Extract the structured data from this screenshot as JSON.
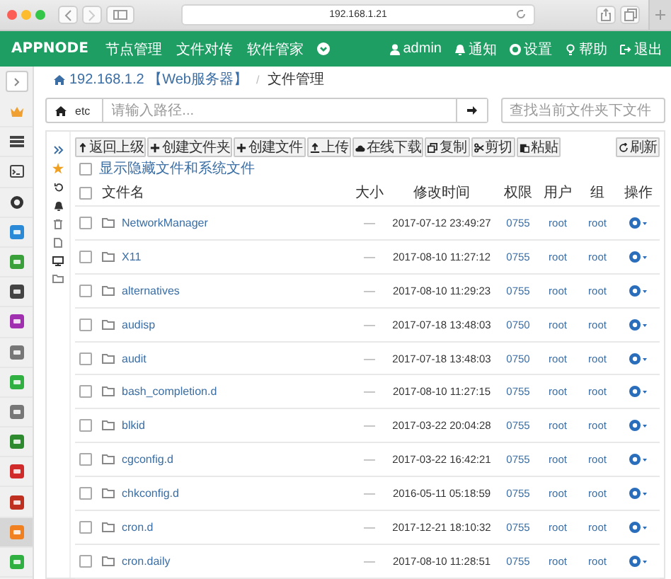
{
  "browser": {
    "address": "192.168.1.21"
  },
  "nav": {
    "logo": "APPNODE",
    "items": [
      {
        "label": "节点管理"
      },
      {
        "label": "文件对传"
      },
      {
        "label": "软件管家"
      }
    ],
    "user_items": [
      {
        "kind": "user",
        "label": "admin"
      },
      {
        "kind": "bell",
        "label": "通知"
      },
      {
        "kind": "gear",
        "label": "设置"
      },
      {
        "kind": "bulb",
        "label": "帮助"
      },
      {
        "kind": "logout",
        "label": "退出"
      }
    ]
  },
  "apps": [
    {
      "kind": "crown",
      "color": "#f0a030",
      "selected": false
    },
    {
      "kind": "list",
      "color": "#444444",
      "selected": false
    },
    {
      "kind": "terminal",
      "color": "#444444",
      "selected": false
    },
    {
      "kind": "gear",
      "color": "#333333",
      "selected": false
    },
    {
      "kind": "tile",
      "color": "#2a8ad8",
      "selected": false
    },
    {
      "kind": "tile",
      "color": "#3aa03a",
      "selected": false
    },
    {
      "kind": "tile",
      "color": "#444444",
      "selected": false
    },
    {
      "kind": "tile",
      "color": "#a030b0",
      "selected": false
    },
    {
      "kind": "tile",
      "color": "#777777",
      "selected": false
    },
    {
      "kind": "tile",
      "color": "#30b040",
      "selected": false
    },
    {
      "kind": "tile",
      "color": "#777777",
      "selected": false
    },
    {
      "kind": "tile",
      "color": "#2e8a2e",
      "selected": false
    },
    {
      "kind": "tile",
      "color": "#d02a2a",
      "selected": false
    },
    {
      "kind": "tile",
      "color": "#c03020",
      "selected": false
    },
    {
      "kind": "tile",
      "color": "#f08020",
      "selected": true
    },
    {
      "kind": "tile",
      "color": "#30b040",
      "selected": false
    }
  ],
  "breadcrumb": {
    "host": "192.168.1.2 【Web服务器】",
    "separator": "/",
    "current": "文件管理"
  },
  "path_bar": {
    "segment": "etc",
    "placeholder": "请输入路径...",
    "search_placeholder": "查找当前文件夹下文件"
  },
  "toolbar": [
    {
      "kind": "up",
      "label": "返回上级"
    },
    {
      "kind": "plus",
      "label": "创建文件夹"
    },
    {
      "kind": "plus",
      "label": "创建文件"
    },
    {
      "kind": "upload",
      "label": "上传"
    },
    {
      "kind": "cloud",
      "label": "在线下载"
    },
    {
      "kind": "copy",
      "label": "复制"
    },
    {
      "kind": "cut",
      "label": "剪切"
    },
    {
      "kind": "paste",
      "label": "粘贴"
    },
    {
      "kind": "refresh",
      "label": "刷新"
    }
  ],
  "show_hidden": {
    "label": "显示隐藏文件和系统文件",
    "checked": false
  },
  "table": {
    "select_all_checked": false,
    "columns": [
      "文件名",
      "大小",
      "修改时间",
      "权限",
      "用户",
      "组",
      "操作"
    ],
    "rows": [
      {
        "name": "NetworkManager",
        "size": "—",
        "modified": "2017-07-12 23:49:27",
        "perms": "0755",
        "user": "root",
        "group": "root",
        "checked": false
      },
      {
        "name": "X11",
        "size": "—",
        "modified": "2017-08-10 11:27:12",
        "perms": "0755",
        "user": "root",
        "group": "root",
        "checked": false
      },
      {
        "name": "alternatives",
        "size": "—",
        "modified": "2017-08-10 11:29:23",
        "perms": "0755",
        "user": "root",
        "group": "root",
        "checked": false
      },
      {
        "name": "audisp",
        "size": "—",
        "modified": "2017-07-18 13:48:03",
        "perms": "0750",
        "user": "root",
        "group": "root",
        "checked": false
      },
      {
        "name": "audit",
        "size": "—",
        "modified": "2017-07-18 13:48:03",
        "perms": "0750",
        "user": "root",
        "group": "root",
        "checked": false
      },
      {
        "name": "bash_completion.d",
        "size": "—",
        "modified": "2017-08-10 11:27:15",
        "perms": "0755",
        "user": "root",
        "group": "root",
        "checked": false
      },
      {
        "name": "blkid",
        "size": "—",
        "modified": "2017-03-22 20:04:28",
        "perms": "0755",
        "user": "root",
        "group": "root",
        "checked": false
      },
      {
        "name": "cgconfig.d",
        "size": "—",
        "modified": "2017-03-22 16:42:21",
        "perms": "0755",
        "user": "root",
        "group": "root",
        "checked": false
      },
      {
        "name": "chkconfig.d",
        "size": "—",
        "modified": "2016-05-11 05:18:59",
        "perms": "0755",
        "user": "root",
        "group": "root",
        "checked": false
      },
      {
        "name": "cron.d",
        "size": "—",
        "modified": "2017-12-21 18:10:32",
        "perms": "0755",
        "user": "root",
        "group": "root",
        "checked": false
      },
      {
        "name": "cron.daily",
        "size": "—",
        "modified": "2017-08-10 11:28:51",
        "perms": "0755",
        "user": "root",
        "group": "root",
        "checked": false
      }
    ]
  }
}
